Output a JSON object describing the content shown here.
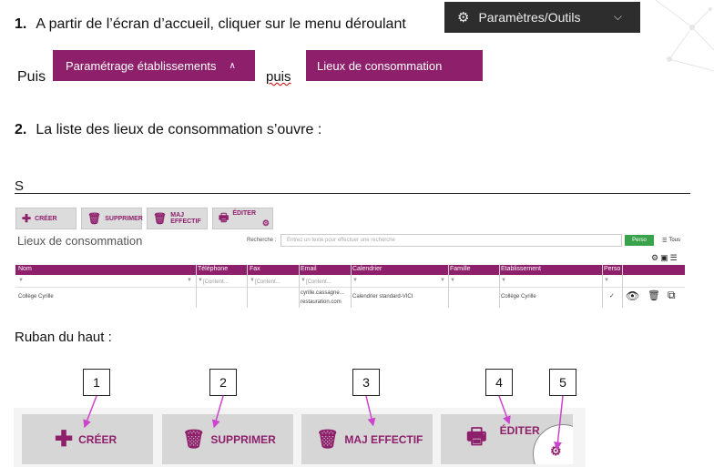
{
  "step1": {
    "number": "1.",
    "text": "A partir de l’écran d’accueil, cliquer sur le menu déroulant",
    "dropdown_label": "Paramètres/Outils",
    "puis1": "Puis",
    "btn_parametrage": "Paramétrage établissements",
    "puis2": "puis",
    "btn_lieux": "Lieux de consommation"
  },
  "step2": {
    "number": "2.",
    "text": "La liste des lieux de consommation s’ouvre :",
    "stray_char": "S"
  },
  "app": {
    "toolbar": {
      "creer": "CRÉER",
      "supprimer": "SUPPRIMER",
      "maj": "MAJ EFFECTIF",
      "editer": "ÉDITER"
    },
    "title": "Lieux de consommation",
    "search_label": "Recherche :",
    "search_placeholder": "Entrez un texte pour effectuer une recherche",
    "perso_btn": "Perso",
    "tous_btn": "Tous",
    "columns": [
      "Nom",
      "Téléphone",
      "Fax",
      "Email",
      "Calendrier",
      "Famille",
      "Etablissement",
      "Perso"
    ],
    "filter_placeholder": "[Content...",
    "row": {
      "nom": "Collège Cyrille",
      "email_line1": "cyrille.cassagne...",
      "email_line2": "restauration.com",
      "calendrier": "Calendrier standard-VICI",
      "etablissement": "Collège Cyrille"
    }
  },
  "ribbon": {
    "heading": "Ruban du haut :",
    "numbers": [
      "1",
      "2",
      "3",
      "4",
      "5"
    ],
    "creer": "CRÉER",
    "supprimer": "SUPPRIMER",
    "maj": "MAJ EFFECTIF",
    "editer": "ÉDITER"
  },
  "colors": {
    "brand": "#8e1f6b",
    "dark": "#2d2d2d",
    "annotation": "#cc44cc"
  }
}
